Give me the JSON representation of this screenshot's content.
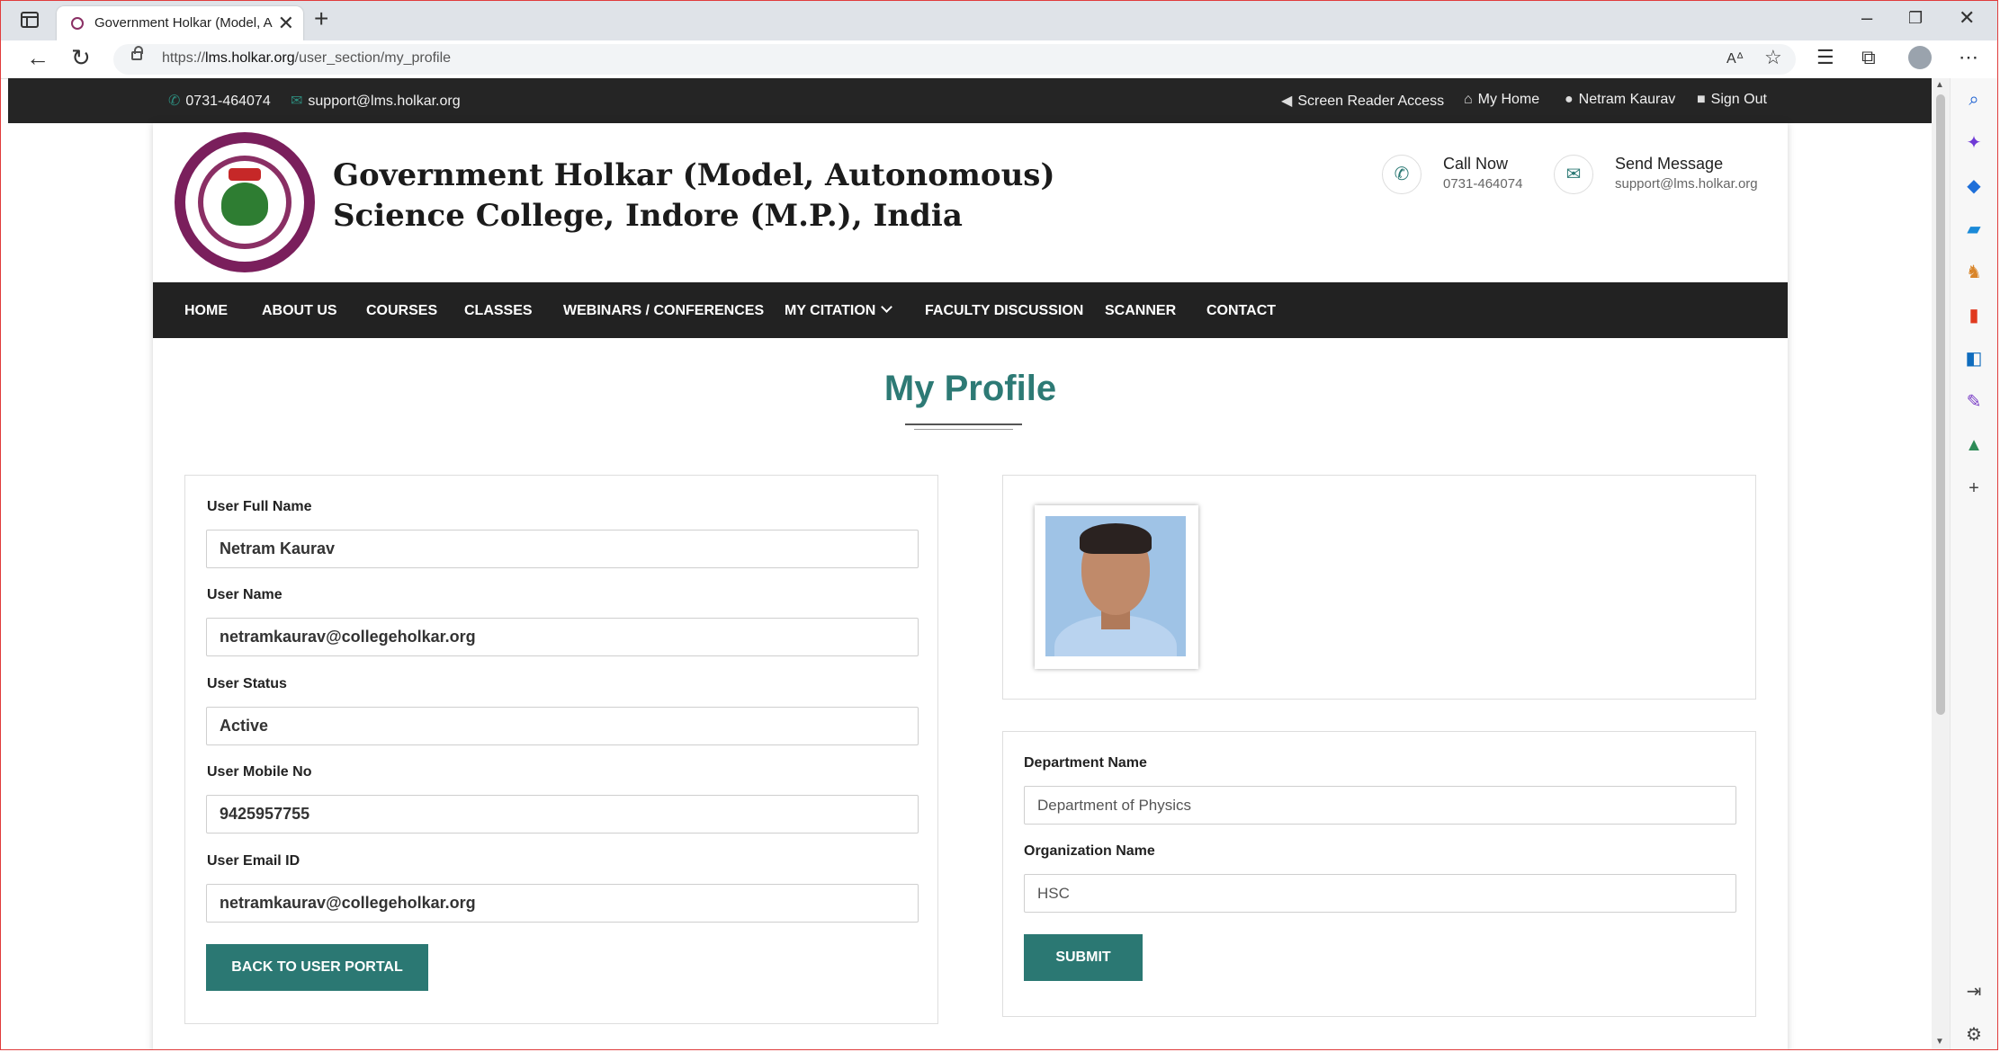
{
  "browser": {
    "tab_title": "Government Holkar (Model, Auto",
    "url_prefix": "https://",
    "url_host": "lms.holkar.org",
    "url_path": "/user_section/my_profile"
  },
  "topbar": {
    "phone": "0731-464074",
    "email": "support@lms.holkar.org",
    "screen_reader": "Screen Reader Access",
    "my_home": "My Home",
    "user_name": "Netram Kaurav",
    "sign_out": "Sign Out"
  },
  "header": {
    "college_line1": "Government Holkar (Model, Autonomous)",
    "college_line2": "Science College, Indore (M.P.), India",
    "call_title": "Call Now",
    "call_number": "0731-464074",
    "message_title": "Send Message",
    "message_email": "support@lms.holkar.org"
  },
  "nav": {
    "home": "HOME",
    "about": "ABOUT US",
    "courses": "COURSES",
    "classes": "CLASSES",
    "webinars": "WEBINARS / CONFERENCES",
    "citation": "MY CITATION",
    "faculty": "FACULTY DISCUSSION",
    "scanner": "SCANNER",
    "contact": "CONTACT"
  },
  "page": {
    "title": "My Profile"
  },
  "profile": {
    "full_name_label": "User Full Name",
    "full_name": "Netram Kaurav",
    "username_label": "User Name",
    "username": "netramkaurav@collegeholkar.org",
    "status_label": "User Status",
    "status": "Active",
    "mobile_label": "User Mobile No",
    "mobile": "9425957755",
    "email_label": "User Email ID",
    "email": "netramkaurav@collegeholkar.org",
    "back_button": "BACK TO USER PORTAL"
  },
  "department_form": {
    "department_label": "Department Name",
    "department_value": "Department of Physics",
    "organization_label": "Organization Name",
    "organization_value": "HSC",
    "submit_button": "SUBMIT"
  },
  "colors": {
    "accent": "#2b7873",
    "topbar_bg": "#252525",
    "nav_bg": "#222222",
    "logo": "#7a1f5c"
  }
}
